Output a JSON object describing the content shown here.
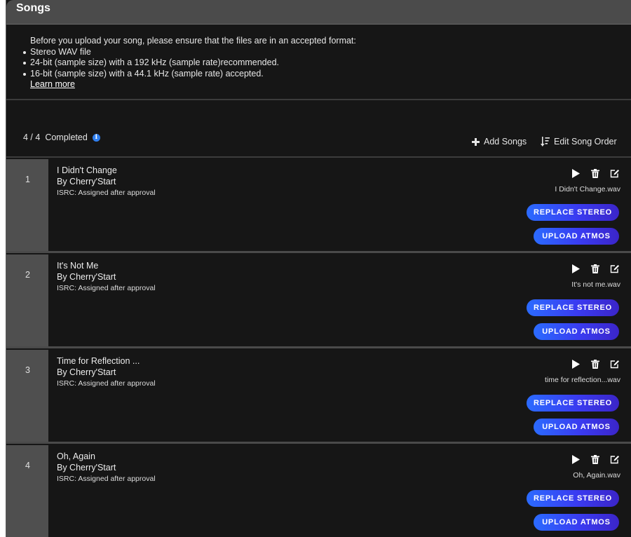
{
  "header": {
    "title": "Songs"
  },
  "info": {
    "intro": "Before you upload your song, please ensure that the files are in an accepted format:",
    "requirements": [
      "Stereo WAV file",
      "24-bit (sample size) with a 192 kHz (sample rate)recommended.",
      "16-bit (sample size) with a 44.1 kHz (sample rate) accepted."
    ],
    "learn_more": "Learn more"
  },
  "toolbar": {
    "completed_count": "4 / 4",
    "completed_label": "Completed",
    "add_songs": "Add Songs",
    "edit_order": "Edit Song Order"
  },
  "songs": [
    {
      "number": "1",
      "title": "I Didn't Change",
      "artist": "By Cherry'Start",
      "isrc": "ISRC: Assigned after approval",
      "file": "I Didn't Change.wav",
      "replace_label": "REPLACE STEREO",
      "atmos_label": "UPLOAD ATMOS"
    },
    {
      "number": "2",
      "title": "It's Not Me",
      "artist": "By Cherry'Start",
      "isrc": "ISRC: Assigned after approval",
      "file": "It's not me.wav",
      "replace_label": "REPLACE STEREO",
      "atmos_label": "UPLOAD ATMOS"
    },
    {
      "number": "3",
      "title": "Time for Reflection ...",
      "artist": "By Cherry'Start",
      "isrc": "ISRC: Assigned after approval",
      "file": "time for reflection...wav",
      "replace_label": "REPLACE STEREO",
      "atmos_label": "UPLOAD ATMOS"
    },
    {
      "number": "4",
      "title": "Oh, Again",
      "artist": "By Cherry'Start",
      "isrc": "ISRC: Assigned after approval",
      "file": "Oh, Again.wav",
      "replace_label": "REPLACE STEREO",
      "atmos_label": "UPLOAD ATMOS"
    }
  ],
  "icons": {
    "play": "play-icon",
    "delete": "trash-icon",
    "edit": "edit-icon",
    "info": "info-icon",
    "add": "plus-icon",
    "order": "sort-icon"
  },
  "colors": {
    "accent_start": "#2b6bff",
    "accent_end": "#3b25c9",
    "info_blue": "#2f7ff0"
  }
}
